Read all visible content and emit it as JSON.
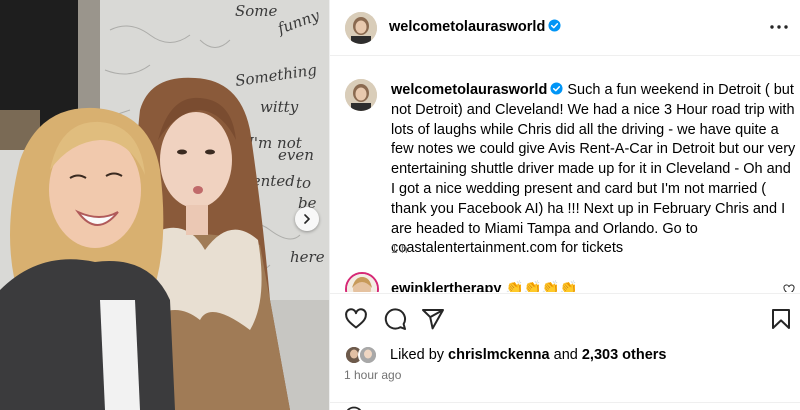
{
  "post": {
    "author": "welcometolaurasworld",
    "caption_author": "welcometolaurasworld",
    "caption_text": "Such a fun weekend in Detroit ( but not Detroit) and Cleveland! We had a nice 3 Hour road trip with lots of laughs while Chris did all the driving - we have quite a few notes we could give Avis Rent-A-Car in Detroit but our very entertaining shuttle driver made up for it in Cleveland - Oh and I got a nice wedding present and card but I'm not married ( thank you Facebook AI) ha !!! Next up in February Chris and I are headed to Miami Tampa and Orlando. Go to coastalentertainment.com for tickets",
    "caption_time": "1 h",
    "more_icon": "more-horizontal-icon"
  },
  "photo": {
    "wall_words": [
      "Some",
      "funny",
      "Something",
      "witty",
      "I'm not",
      "even",
      "talented",
      "to",
      "be",
      "here"
    ]
  },
  "comment": {
    "username": "ewinklertherapy",
    "emojis": "👏👏👏👏"
  },
  "actions": {
    "icons": [
      "heart-icon",
      "comment-icon",
      "share-icon",
      "bookmark-icon"
    ],
    "liked_by_prefix": "Liked by ",
    "liked_by_user": "chrislmckenna",
    "liked_by_middle": " and ",
    "liked_by_count": "2,303 others",
    "time": "1 hour ago"
  },
  "colors": {
    "verified": "#0095f6",
    "secondary_text": "#737373",
    "divider": "#efefef",
    "photo_wall": "#d9d9d6"
  }
}
